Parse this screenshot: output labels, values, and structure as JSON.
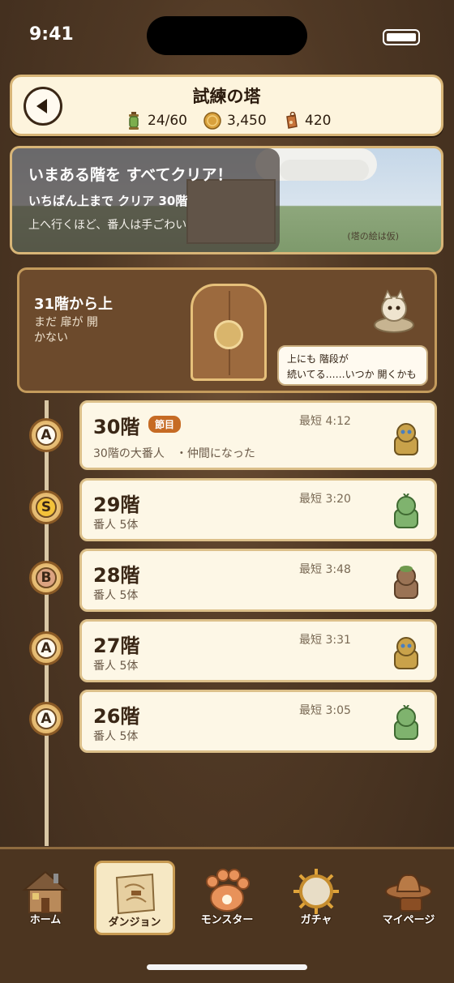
{
  "status_bar": {
    "time": "9:41"
  },
  "header": {
    "title": "試練の塔",
    "stats": [
      {
        "icon": "lantern-icon",
        "value": "24/60"
      },
      {
        "icon": "coin-icon",
        "value": "3,450"
      },
      {
        "icon": "key-tag-icon",
        "value": "420"
      }
    ]
  },
  "banner": {
    "line1": "いまある階を すべてクリア！",
    "line2": "いちばん上まで クリア 30階",
    "line3": "上へ行くほど、番人は手ごわい",
    "note": "(塔の絵は仮)"
  },
  "locked_floor": {
    "title": "31階から上",
    "subtitle": "まだ 扉が 開かない",
    "bubble_line1": "上にも 階段が",
    "bubble_line2": "続いてる……いつか 開くかも"
  },
  "floors": [
    {
      "rank": "A",
      "name": "30階",
      "badge": "節目",
      "best": "最短 4:12",
      "sub": "30階の大番人　・仲間になった",
      "monster_color": "#c9a24a"
    },
    {
      "rank": "S",
      "name": "29階",
      "badge": "",
      "best": "最短 3:20",
      "sub": "番人 5体",
      "monster_color": "#7fb36e"
    },
    {
      "rank": "B",
      "name": "28階",
      "badge": "",
      "best": "最短 3:48",
      "sub": "番人 5体",
      "monster_color": "#9a7355"
    },
    {
      "rank": "A",
      "name": "27階",
      "badge": "",
      "best": "最短 3:31",
      "sub": "番人 5体",
      "monster_color": "#c9a24a"
    },
    {
      "rank": "A",
      "name": "26階",
      "badge": "",
      "best": "最短 3:05",
      "sub": "番人 5体",
      "monster_color": "#7fb36e"
    }
  ],
  "nav": [
    {
      "label": "ホーム",
      "icon": "house-icon",
      "active": false
    },
    {
      "label": "ダンジョン",
      "icon": "map-icon",
      "active": true
    },
    {
      "label": "モンスター",
      "icon": "paw-icon",
      "active": false
    },
    {
      "label": "ガチャ",
      "icon": "sun-orb-icon",
      "active": false
    },
    {
      "label": "マイページ",
      "icon": "hat-icon",
      "active": false
    }
  ]
}
